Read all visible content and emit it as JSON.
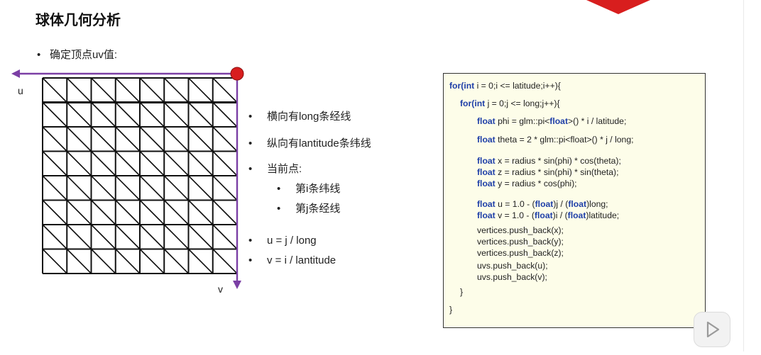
{
  "slide": {
    "title": "球体几何分析",
    "top_bullet": "确定顶点uv值:",
    "bullet_symbol": "•",
    "bullets": [
      {
        "text": "横向有long条经线",
        "level": 1
      },
      {
        "text": "纵向有lantitude条纬线",
        "level": 1
      },
      {
        "text": "当前点:",
        "level": 1
      },
      {
        "text": "第i条纬线",
        "level": 2
      },
      {
        "text": "第j条经线",
        "level": 2
      },
      {
        "text": "u = j / long",
        "level": 1
      },
      {
        "text": "v = i / lantitude",
        "level": 1
      }
    ],
    "axis_u": "u",
    "axis_v": "v"
  },
  "code": {
    "lines": [
      [
        {
          "t": "for(",
          "k": true
        },
        {
          "t": "int",
          "k": true
        },
        {
          "t": " i = 0;i <= latitude;i++){",
          "k": false
        }
      ],
      [
        {
          "t": "for(",
          "k": true
        },
        {
          "t": "int",
          "k": true
        },
        {
          "t": " j = 0;j <= long;j++){",
          "k": false
        }
      ],
      [
        {
          "t": "float",
          "k": true
        },
        {
          "t": " phi = glm::pi<",
          "k": false
        },
        {
          "t": "float",
          "k": true
        },
        {
          "t": ">() * i / latitude;",
          "k": false
        }
      ],
      [
        {
          "t": "float",
          "k": true
        },
        {
          "t": " theta = 2 * glm::pi<float>() * j / long;",
          "k": false
        }
      ],
      [
        {
          "t": "float",
          "k": true
        },
        {
          "t": " x = radius * sin(phi) * cos(theta);",
          "k": false
        }
      ],
      [
        {
          "t": "float",
          "k": true
        },
        {
          "t": " z = radius * sin(phi) * sin(theta);",
          "k": false
        }
      ],
      [
        {
          "t": "float",
          "k": true
        },
        {
          "t": " y = radius * cos(phi);",
          "k": false
        }
      ],
      [
        {
          "t": "float",
          "k": true
        },
        {
          "t": " u = 1.0 - (",
          "k": false
        },
        {
          "t": "float",
          "k": true
        },
        {
          "t": ")j / (",
          "k": false
        },
        {
          "t": "float",
          "k": true
        },
        {
          "t": ")long;",
          "k": false
        }
      ],
      [
        {
          "t": "float",
          "k": true
        },
        {
          "t": " v = 1.0 - (",
          "k": false
        },
        {
          "t": "float",
          "k": true
        },
        {
          "t": ")i / (",
          "k": false
        },
        {
          "t": "float",
          "k": true
        },
        {
          "t": ")latitude;",
          "k": false
        }
      ],
      [
        {
          "t": "vertices.push_back(x);",
          "k": false
        }
      ],
      [
        {
          "t": "vertices.push_back(y);",
          "k": false
        }
      ],
      [
        {
          "t": "vertices.push_back(z);",
          "k": false
        }
      ],
      [
        {
          "t": "uvs.push_back(u);",
          "k": false
        }
      ],
      [
        {
          "t": "uvs.push_back(v);",
          "k": false
        }
      ],
      [
        {
          "t": "}",
          "k": false
        }
      ],
      [
        {
          "t": "}",
          "k": false
        }
      ]
    ]
  },
  "grid": {
    "rows": 8,
    "cols": 8
  },
  "colors": {
    "axis": "#7b3fa5",
    "origin_point": "#d81e1e",
    "keyword": "#1f3fa8",
    "code_bg": "#fdfde9",
    "top_shape": "#d81e1e"
  },
  "icons": {
    "play": "play-icon",
    "origin": "red-dot-icon"
  }
}
